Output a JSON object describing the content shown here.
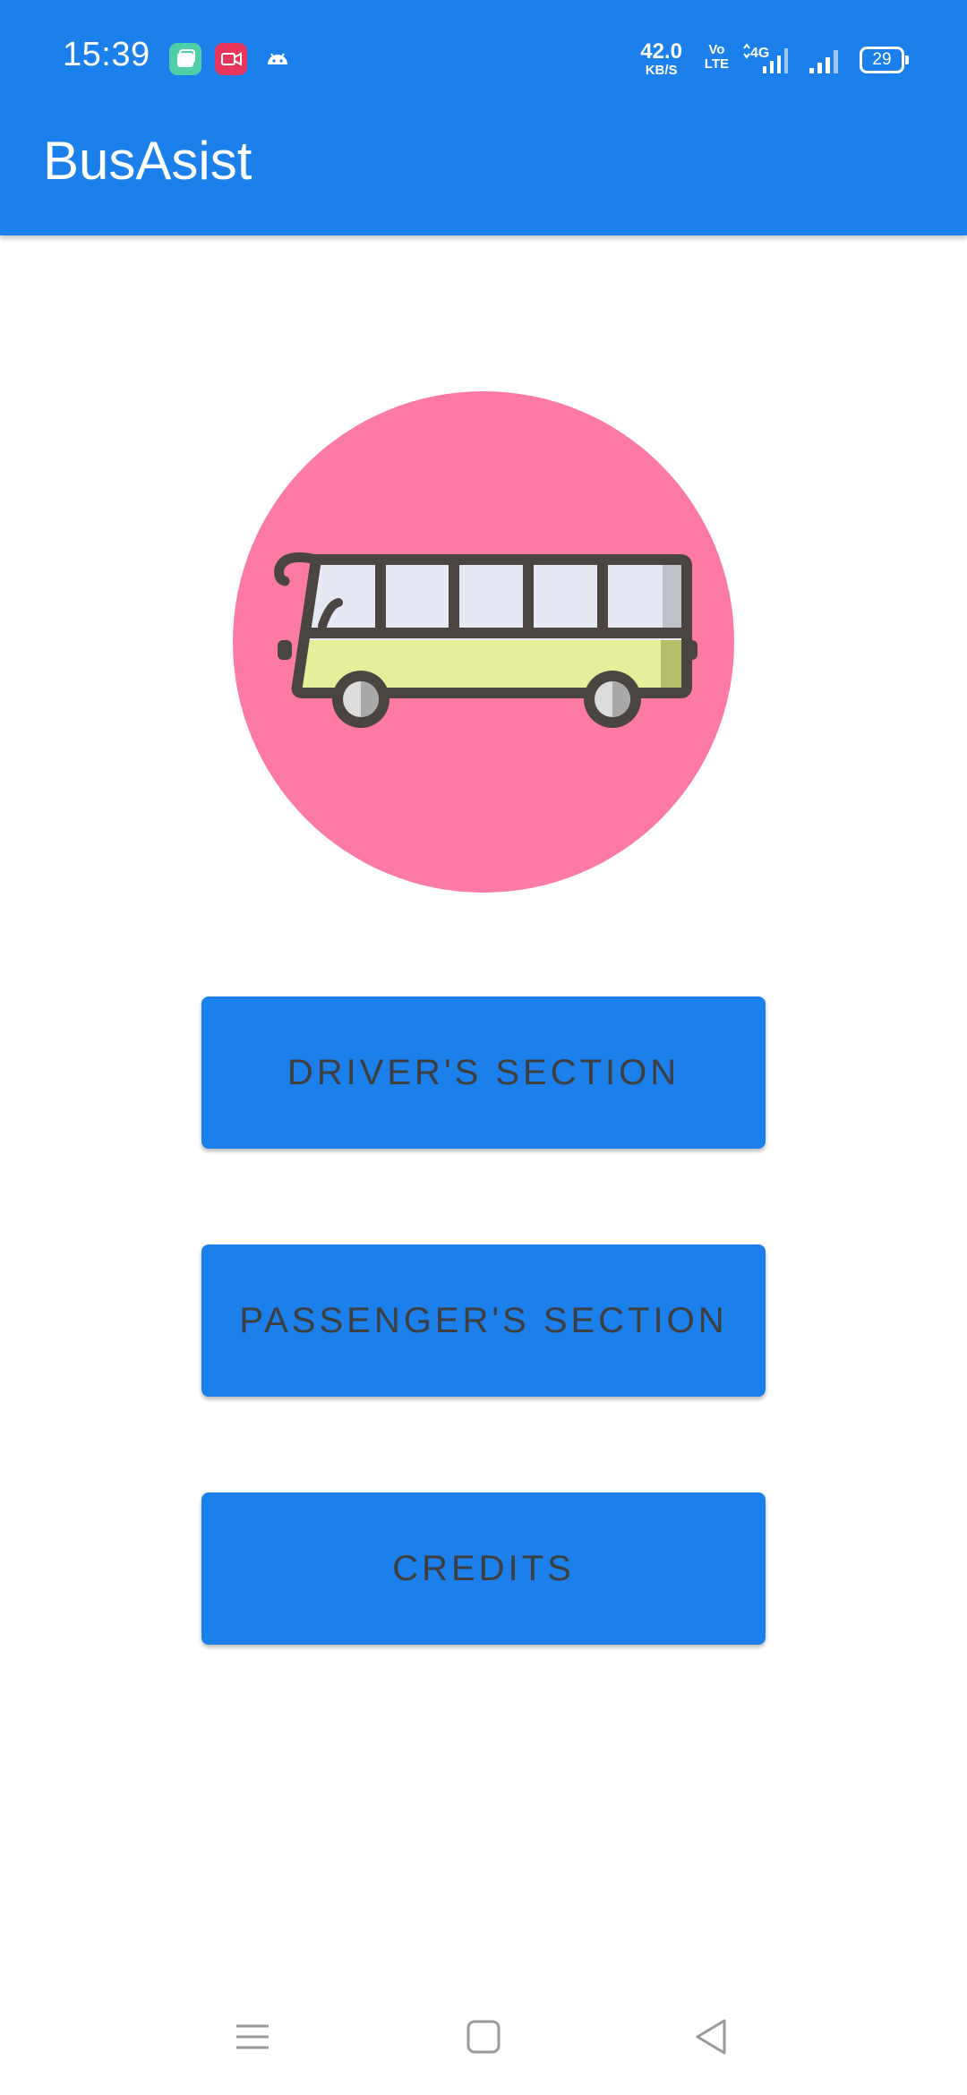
{
  "status_bar": {
    "time": "15:39",
    "net_speed_value": "42.0",
    "net_speed_unit": "KB/S",
    "volte_line1": "Vo",
    "volte_line2": "LTE",
    "network_type": "4G",
    "battery_level": "29",
    "app_icons": [
      "gallery-icon",
      "screen-recorder-icon",
      "android-icon"
    ]
  },
  "app_bar": {
    "title": "BusAsist"
  },
  "logo": {
    "icon": "bus-icon",
    "circle_color": "#fd7aa5"
  },
  "buttons": {
    "driver": "DRIVER'S SECTION",
    "passenger": "PASSENGER'S SECTION",
    "credits": "CREDITS"
  },
  "nav_bar": {
    "icons": [
      "menu-icon",
      "home-icon",
      "back-icon"
    ]
  },
  "colors": {
    "primary": "#1b7fec",
    "button_text": "#3e3e3e",
    "background": "#ffffff"
  }
}
